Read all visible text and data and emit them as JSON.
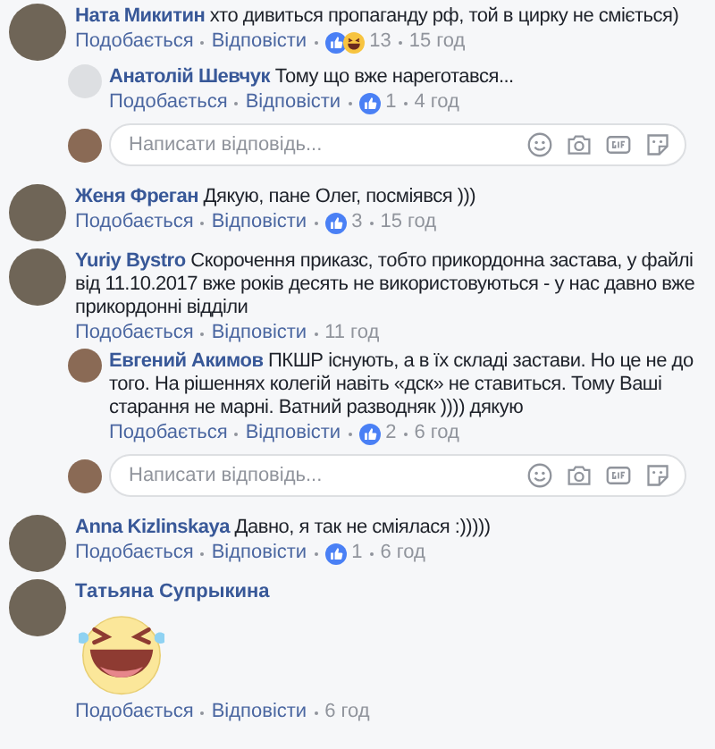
{
  "comments": [
    {
      "author": "Ната Микитин",
      "text": "хто дивиться пропаганду рф, той в цирку не сміється)",
      "actions": [
        "Подобається",
        "Відповісти"
      ],
      "reactions": [
        {
          "kind": "like"
        },
        {
          "kind": "haha"
        }
      ],
      "count": "13",
      "time": "15 год",
      "replies": [
        {
          "author": "Анатолій Шевчук",
          "text": "Тому що вже нареготався...",
          "actions": [
            "Подобається",
            "Відповісти"
          ],
          "kind": "no_photo",
          "reactions": [
            {
              "kind": "like"
            }
          ],
          "count": "1",
          "time": "4 год"
        }
      ],
      "reply_box": {
        "placeholder": "Написати відповідь..."
      }
    },
    {
      "author": "Женя Фреган",
      "text": "Дякую, пане Олег, посміявся )))",
      "actions": [
        "Подобається",
        "Відповісти"
      ],
      "reactions": [
        {
          "kind": "like"
        }
      ],
      "count": "3",
      "time": "15 год"
    },
    {
      "author": "Yuriy Bystro",
      "text": "Скорочення приказс, тобто прикордонна застава, у файлі від 11.10.2017 вже років десять не використовуються - у нас давно вже прикордонні відділи",
      "actions": [
        "Подобається",
        "Відповісти"
      ],
      "time": "11 год",
      "replies": [
        {
          "author": "Евгений Акимов",
          "text": "ПКШР існують, а в їх складі застави. Но це не до того. На рішеннях колегій навіть «дск» не ставиться. Тому Ваші старання не марні. Ватний разводняк )))) дякую",
          "actions": [
            "Подобається",
            "Відповісти"
          ],
          "kind": "photo",
          "reactions": [
            {
              "kind": "like"
            }
          ],
          "count": "2",
          "time": "6 год"
        }
      ],
      "reply_box": {
        "placeholder": "Написати відповідь..."
      }
    },
    {
      "author": "Anna Kizlinskaya",
      "text": "Давно, я так не сміялася :)))))",
      "actions": [
        "Подобається",
        "Відповісти"
      ],
      "reactions": [
        {
          "kind": "like"
        }
      ],
      "count": "1",
      "time": "6 год"
    },
    {
      "author": "Татьяна Супрыкина",
      "sticker": {
        "kind": "laughing"
      },
      "actions": [
        "Подобається",
        "Відповісти"
      ],
      "time": "6 год"
    }
  ]
}
